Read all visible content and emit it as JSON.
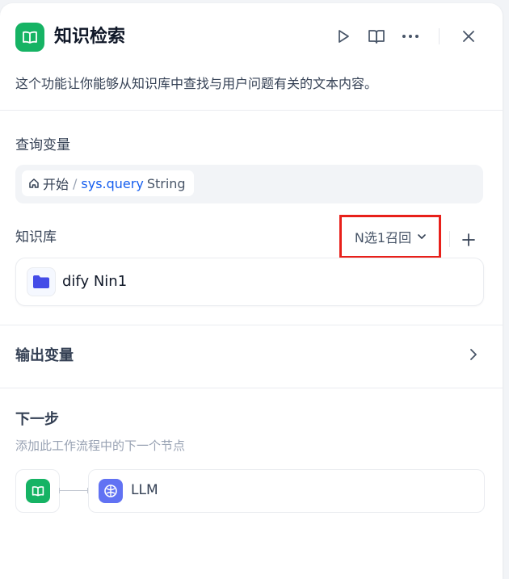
{
  "header": {
    "title": "知识检索",
    "icon": "book-open-icon",
    "accent": "#16b364",
    "actions": [
      "play-icon",
      "book-icon",
      "more-icon",
      "close-icon"
    ]
  },
  "description": "这个功能让你能够从知识库中查找与用户问题有关的文本内容。",
  "query_variable": {
    "label": "查询变量",
    "source_icon": "home-icon",
    "source": "开始",
    "separator": "/",
    "name": "sys.query",
    "type": "String"
  },
  "knowledge_base": {
    "label": "知识库",
    "retrieval_mode": "N选1召回",
    "add_icon": "plus-icon",
    "items": [
      {
        "name": "dify Nin1",
        "icon": "folder-icon",
        "icon_color": "#444ce7"
      }
    ]
  },
  "output": {
    "label": "输出变量"
  },
  "next_step": {
    "title": "下一步",
    "subtitle": "添加此工作流程中的下一个节点",
    "next_node": {
      "name": "LLM",
      "icon": "brain-icon",
      "color": "#6172f3"
    }
  },
  "highlight_color": "#e8201a"
}
